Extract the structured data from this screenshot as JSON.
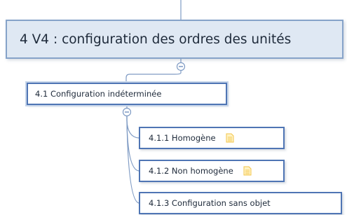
{
  "diagram": {
    "root": {
      "label": "4 V4 : configuration des ordres des unités",
      "collapse_symbol": "⊖"
    },
    "level1": {
      "label": "4.1  Configuration indéterminée",
      "collapse_symbol": "⊖"
    },
    "level2": [
      {
        "label": "4.1.1  Homogène",
        "has_note": true
      },
      {
        "label": "4.1.2  Non homogène",
        "has_note": true
      },
      {
        "label": "4.1.3  Configuration sans objet",
        "has_note": false
      }
    ]
  },
  "colors": {
    "root_fill": "#dfe8f3",
    "root_border": "#86a3c9",
    "node_border": "#4f75b4",
    "connector": "#7f9bc4",
    "note_icon": "#f3c44b"
  }
}
